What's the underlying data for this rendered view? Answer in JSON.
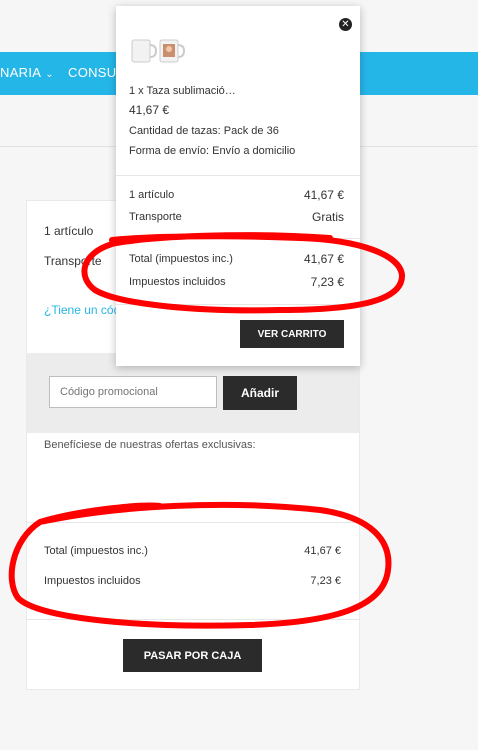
{
  "nav": {
    "items": [
      "NARIA",
      "CONSU"
    ]
  },
  "cart_summary": {
    "items_count": "1 artículo",
    "shipping_label": "Transporte",
    "promo_link": "¿Tiene un cód",
    "promo_placeholder": "Código promocional",
    "promo_button": "Añadir",
    "offers_text": "Benefíciese de nuestras ofertas exclusivas:",
    "total_label": "Total (impuestos inc.)",
    "total_value": "41,67 €",
    "taxes_label": "Impuestos incluidos",
    "taxes_value": "7,23 €",
    "checkout_button": "PASAR POR CAJA"
  },
  "popup": {
    "product_qty_name": "1 x  Taza sublimació…",
    "product_price": "41,67 €",
    "attr_quantity": "Cantidad de tazas: Pack de 36",
    "attr_shipping": "Forma de envío: Envío a domicilio",
    "items_label": "1 artículo",
    "items_value": "41,67 €",
    "shipping_label": "Transporte",
    "shipping_value": "Gratis",
    "total_label": "Total (impuestos inc.)",
    "total_value": "41,67 €",
    "taxes_label": "Impuestos incluidos",
    "taxes_value": "7,23 €",
    "view_cart_button": "VER CARRITO",
    "close_icon": "close-icon"
  },
  "colors": {
    "nav_blue": "#25b6e8",
    "button_dark": "#2b2b2b",
    "annotation_red": "#ff0000"
  }
}
